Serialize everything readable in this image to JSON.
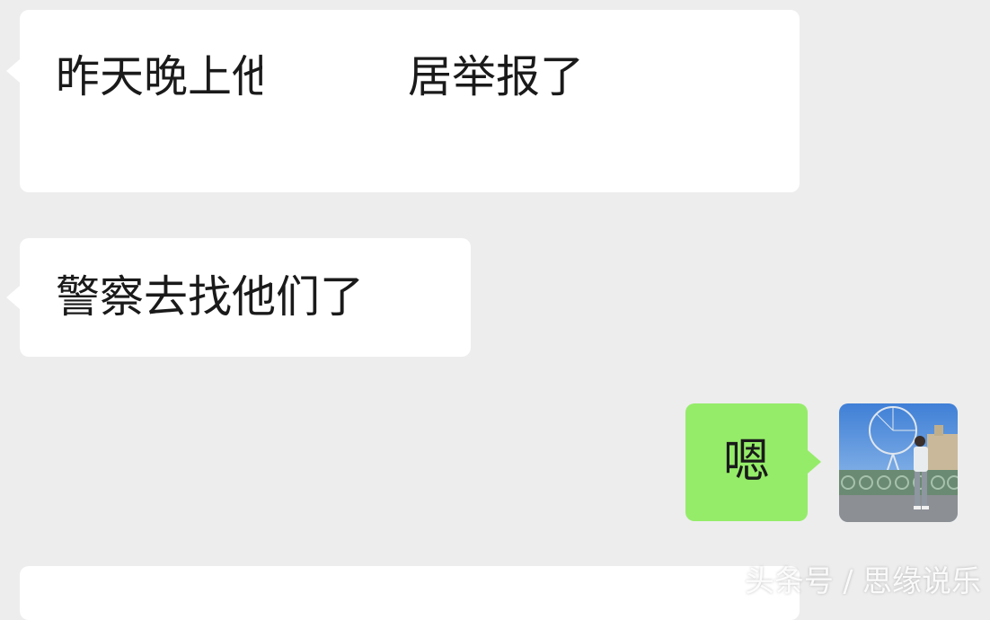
{
  "messages": [
    {
      "side": "left",
      "text": "昨天晚上他们被邻居举报了"
    },
    {
      "side": "left",
      "text": "警察去找他们了"
    },
    {
      "side": "right",
      "text": "嗯"
    }
  ],
  "watermark": "头条号 / 思缘说乐",
  "colors": {
    "background": "#ededed",
    "received_bubble": "#ffffff",
    "sent_bubble": "#95ec69"
  }
}
